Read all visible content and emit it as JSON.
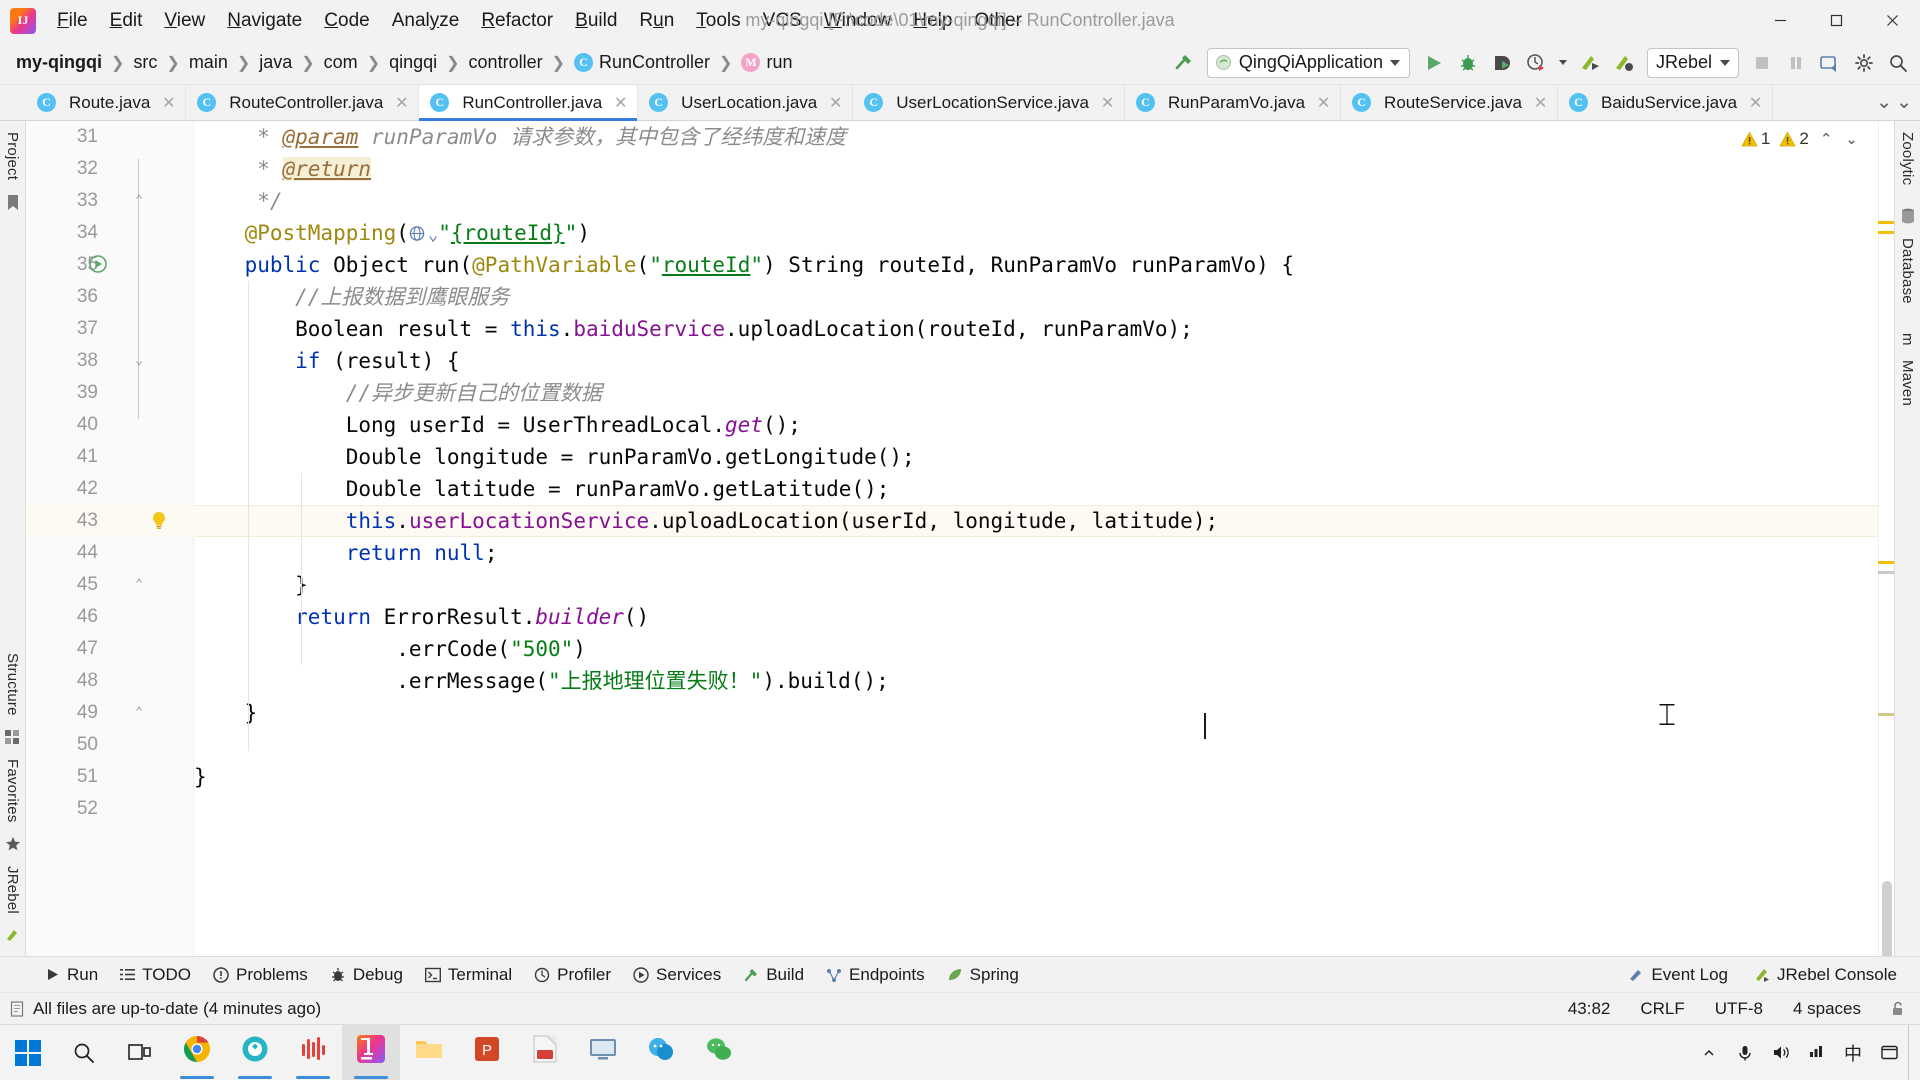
{
  "window": {
    "title": "my-qingqi [F:\\code\\01\\my-qingqi] – RunController.java",
    "minimize": "–",
    "maximize": "❐",
    "close": "✕"
  },
  "menu": [
    {
      "label": "File",
      "mnemonic": "F"
    },
    {
      "label": "Edit",
      "mnemonic": "E"
    },
    {
      "label": "View",
      "mnemonic": "V"
    },
    {
      "label": "Navigate",
      "mnemonic": "N"
    },
    {
      "label": "Code",
      "mnemonic": "C"
    },
    {
      "label": "Analyze",
      "mnemonic": "y"
    },
    {
      "label": "Refactor",
      "mnemonic": "R"
    },
    {
      "label": "Build",
      "mnemonic": "B"
    },
    {
      "label": "Run",
      "mnemonic": "u"
    },
    {
      "label": "Tools",
      "mnemonic": "T"
    },
    {
      "label": "VCS",
      "mnemonic": ""
    },
    {
      "label": "Window",
      "mnemonic": "W"
    },
    {
      "label": "Help",
      "mnemonic": "H"
    },
    {
      "label": "Other",
      "mnemonic": ""
    }
  ],
  "breadcrumb": [
    {
      "label": "my-qingqi",
      "badge": "",
      "bold": true
    },
    {
      "label": "src",
      "badge": "",
      "bold": false
    },
    {
      "label": "main",
      "badge": "",
      "bold": false
    },
    {
      "label": "java",
      "badge": "",
      "bold": false
    },
    {
      "label": "com",
      "badge": "",
      "bold": false
    },
    {
      "label": "qingqi",
      "badge": "",
      "bold": false
    },
    {
      "label": "controller",
      "badge": "",
      "bold": false
    },
    {
      "label": "RunController",
      "badge": "c",
      "bold": false
    },
    {
      "label": "run",
      "badge": "m",
      "bold": false
    }
  ],
  "toolbar": {
    "run_config": "QingQiApplication",
    "jrebel_label": "JRebel",
    "icons": [
      "build-hammer-icon",
      "run-icon",
      "debug-icon",
      "run-coverage-icon",
      "profiler-icon",
      "jrebel-run-icon",
      "jrebel-debug-icon",
      "stop-icon",
      "pause-icon",
      "update-app-icon",
      "settings-icon",
      "search-everywhere-icon"
    ]
  },
  "tabs": [
    {
      "label": "Route.java",
      "icon": "c",
      "active": false
    },
    {
      "label": "RouteController.java",
      "icon": "c",
      "active": false
    },
    {
      "label": "RunController.java",
      "icon": "c",
      "active": true
    },
    {
      "label": "UserLocation.java",
      "icon": "c",
      "active": false
    },
    {
      "label": "UserLocationService.java",
      "icon": "c",
      "active": false
    },
    {
      "label": "RunParamVo.java",
      "icon": "c",
      "active": false
    },
    {
      "label": "RouteService.java",
      "icon": "c",
      "active": false
    },
    {
      "label": "BaiduService.java",
      "icon": "c",
      "active": false
    }
  ],
  "left_rail": {
    "project_label": "Project",
    "structure_label": "Structure",
    "favorites_label": "Favorites",
    "jrebel_label": "JRebel",
    "icons": [
      "project-icon",
      "bookmark-icon",
      "structure-icon",
      "favorites-star-icon",
      "jrebel-icon"
    ]
  },
  "right_rail": {
    "items": [
      "Zoolytic",
      "Database",
      "m",
      "Maven"
    ]
  },
  "inspections": {
    "warning_count": "1",
    "weak_warning_count": "2",
    "warning_icon": "warning-triangle-icon",
    "weak_warning_icon": "weak-warning-triangle-icon",
    "up_chevron": "⌃",
    "down_chevron": "⌄"
  },
  "editor": {
    "lines": [
      {
        "no": "31",
        "tokens": [
          {
            "t": "     * ",
            "c": "doc"
          },
          {
            "t": "@param",
            "c": "tag"
          },
          {
            "t": " runParamVo ",
            "c": "doc"
          },
          {
            "t": "请求参数，其中包含了经纬度和速度",
            "c": "doc"
          }
        ],
        "fold": "",
        "highlight": false
      },
      {
        "no": "32",
        "tokens": [
          {
            "t": "     * ",
            "c": "doc"
          },
          {
            "t": "@return",
            "c": "tag hlt"
          }
        ],
        "fold": "",
        "highlight": false
      },
      {
        "no": "33",
        "tokens": [
          {
            "t": "     */",
            "c": "doc"
          }
        ],
        "fold": "end",
        "highlight": false
      },
      {
        "no": "34",
        "tokens": [
          {
            "t": "    @PostMapping",
            "c": "ann"
          },
          {
            "t": "(",
            "c": ""
          },
          {
            "t": "@GLOBE",
            "c": "globe"
          },
          {
            "t": "\"",
            "c": "str"
          },
          {
            "t": "{routeId}",
            "c": "str ul"
          },
          {
            "t": "\"",
            "c": "str"
          },
          {
            "t": ")",
            "c": ""
          }
        ],
        "fold": "",
        "highlight": false
      },
      {
        "no": "35",
        "tokens": [
          {
            "t": "    ",
            "c": ""
          },
          {
            "t": "public",
            "c": "kw"
          },
          {
            "t": " Object run(",
            "c": ""
          },
          {
            "t": "@PathVariable",
            "c": "ann"
          },
          {
            "t": "(",
            "c": ""
          },
          {
            "t": "\"",
            "c": "str"
          },
          {
            "t": "routeId",
            "c": "str ul"
          },
          {
            "t": "\"",
            "c": "str"
          },
          {
            "t": ") String routeId, RunParamVo runParamVo) {",
            "c": ""
          }
        ],
        "fold": "",
        "highlight": false,
        "runmark": true
      },
      {
        "no": "36",
        "tokens": [
          {
            "t": "        //上报数据到鹰眼服务",
            "c": "cmt"
          }
        ],
        "fold": "",
        "highlight": false
      },
      {
        "no": "37",
        "tokens": [
          {
            "t": "        Boolean result = ",
            "c": ""
          },
          {
            "t": "this",
            "c": "kw"
          },
          {
            "t": ".",
            "c": ""
          },
          {
            "t": "baiduService",
            "c": "fld"
          },
          {
            "t": ".uploadLocation(routeId, runParamVo);",
            "c": ""
          }
        ],
        "fold": "",
        "highlight": false
      },
      {
        "no": "38",
        "tokens": [
          {
            "t": "        ",
            "c": ""
          },
          {
            "t": "if",
            "c": "kw"
          },
          {
            "t": " (result) {",
            "c": ""
          }
        ],
        "fold": "start",
        "highlight": false
      },
      {
        "no": "39",
        "tokens": [
          {
            "t": "            //异步更新自己的位置数据",
            "c": "cmt"
          }
        ],
        "fold": "",
        "highlight": false
      },
      {
        "no": "40",
        "tokens": [
          {
            "t": "            Long userId = UserThreadLocal.",
            "c": ""
          },
          {
            "t": "get",
            "c": "sfld"
          },
          {
            "t": "();",
            "c": ""
          }
        ],
        "fold": "",
        "highlight": false
      },
      {
        "no": "41",
        "tokens": [
          {
            "t": "            Double longitude = runParamVo.getLongitude();",
            "c": ""
          }
        ],
        "fold": "",
        "highlight": false
      },
      {
        "no": "42",
        "tokens": [
          {
            "t": "            Double latitude = runParamVo.getLatitude();",
            "c": ""
          }
        ],
        "fold": "",
        "highlight": false
      },
      {
        "no": "43",
        "tokens": [
          {
            "t": "            ",
            "c": ""
          },
          {
            "t": "this",
            "c": "kw"
          },
          {
            "t": ".",
            "c": ""
          },
          {
            "t": "userLocationService",
            "c": "fld"
          },
          {
            "t": ".uploadLocation(userId, longitude, latitude);",
            "c": ""
          }
        ],
        "fold": "",
        "highlight": true,
        "bulb": true
      },
      {
        "no": "44",
        "tokens": [
          {
            "t": "            ",
            "c": ""
          },
          {
            "t": "return",
            "c": "kw"
          },
          {
            "t": " ",
            "c": ""
          },
          {
            "t": "null",
            "c": "kw"
          },
          {
            "t": ";",
            "c": ""
          }
        ],
        "fold": "",
        "highlight": false
      },
      {
        "no": "45",
        "tokens": [
          {
            "t": "        }",
            "c": ""
          }
        ],
        "fold": "end",
        "highlight": false
      },
      {
        "no": "46",
        "tokens": [
          {
            "t": "        ",
            "c": ""
          },
          {
            "t": "return",
            "c": "kw"
          },
          {
            "t": " ErrorResult.",
            "c": ""
          },
          {
            "t": "builder",
            "c": "sfld"
          },
          {
            "t": "()",
            "c": ""
          }
        ],
        "fold": "",
        "highlight": false
      },
      {
        "no": "47",
        "tokens": [
          {
            "t": "                .errCode(",
            "c": ""
          },
          {
            "t": "\"500\"",
            "c": "str"
          },
          {
            "t": ")",
            "c": ""
          }
        ],
        "fold": "",
        "highlight": false
      },
      {
        "no": "48",
        "tokens": [
          {
            "t": "                .errMessage(",
            "c": ""
          },
          {
            "t": "\"上报地理位置失败！\"",
            "c": "str"
          },
          {
            "t": ").build();",
            "c": ""
          }
        ],
        "fold": "",
        "highlight": false
      },
      {
        "no": "49",
        "tokens": [
          {
            "t": "    }",
            "c": ""
          }
        ],
        "fold": "end",
        "highlight": false
      },
      {
        "no": "50",
        "tokens": [],
        "fold": "",
        "highlight": false
      },
      {
        "no": "51",
        "tokens": [
          {
            "t": "}",
            "c": ""
          }
        ],
        "fold": "",
        "highlight": false
      },
      {
        "no": "52",
        "tokens": [],
        "fold": "",
        "highlight": false
      }
    ]
  },
  "tool_windows": [
    {
      "label": "Run",
      "icon": "run-play-icon"
    },
    {
      "label": "TODO",
      "icon": "todo-list-icon"
    },
    {
      "label": "Problems",
      "icon": "problems-icon"
    },
    {
      "label": "Debug",
      "icon": "debug-bug-icon"
    },
    {
      "label": "Terminal",
      "icon": "terminal-icon"
    },
    {
      "label": "Profiler",
      "icon": "profiler-icon"
    },
    {
      "label": "Services",
      "icon": "services-icon"
    },
    {
      "label": "Build",
      "icon": "build-hammer-icon"
    },
    {
      "label": "Endpoints",
      "icon": "endpoints-icon"
    },
    {
      "label": "Spring",
      "icon": "spring-leaf-icon"
    }
  ],
  "tool_windows_right": [
    {
      "label": "Event Log",
      "icon": "event-log-icon"
    },
    {
      "label": "JRebel Console",
      "icon": "jrebel-icon"
    }
  ],
  "status": {
    "message": "All files are up-to-date (4 minutes ago)",
    "message_icon": "document-icon",
    "caret_position": "43:82",
    "line_separator": "CRLF",
    "encoding": "UTF-8",
    "indent": "4 spaces",
    "lock_icon": "unlock-icon"
  },
  "taskbar": {
    "start_icon": "windows-start-icon",
    "search_icon": "search-icon",
    "taskview_icon": "task-view-icon",
    "apps": [
      {
        "name": "google-chrome",
        "active": true
      },
      {
        "name": "browser-360",
        "active": false
      },
      {
        "name": "music-app",
        "active": false
      },
      {
        "name": "intellij-idea",
        "active": true
      },
      {
        "name": "file-explorer",
        "active": false
      },
      {
        "name": "powerpoint",
        "active": false
      },
      {
        "name": "pdf-reader",
        "active": false
      },
      {
        "name": "remote-desktop",
        "active": false
      },
      {
        "name": "chat-app",
        "active": false
      },
      {
        "name": "wechat",
        "active": false
      }
    ],
    "tray": [
      "show-hidden-icons",
      "microphone-icon",
      "volume-icon",
      "network-icon",
      "ime-chinese",
      "notifications-icon"
    ],
    "ime_label": "中"
  },
  "colors": {
    "accent": "#3b7ddd",
    "keyword": "#0033b3",
    "string": "#067d17",
    "comment": "#8c8c8c",
    "annotation": "#9e880d",
    "field": "#871094",
    "highlight_line": "#fcfaf2"
  }
}
